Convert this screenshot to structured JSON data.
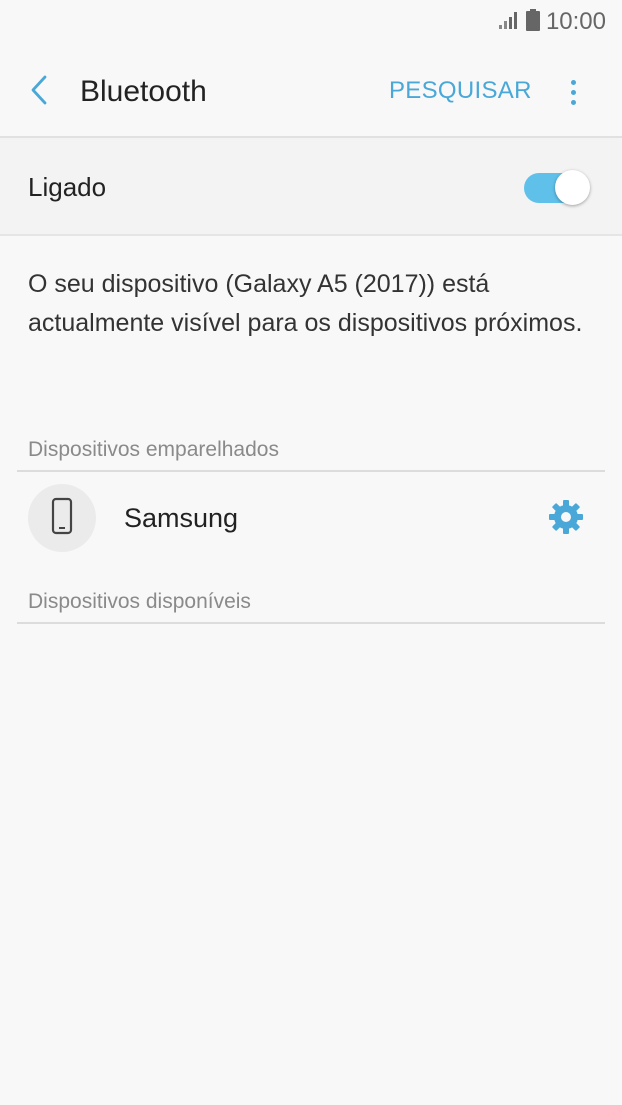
{
  "status_bar": {
    "time": "10:00",
    "signal_icon": "signal-icon",
    "battery_icon": "battery-icon"
  },
  "header": {
    "title": "Bluetooth",
    "back_icon": "chevron-left-icon",
    "search_label": "PESQUISAR",
    "more_icon": "more-vertical-icon"
  },
  "bluetooth_toggle": {
    "label": "Ligado",
    "state": true
  },
  "visibility_message": "O seu dispositivo (Galaxy A5 (2017)) está actualmente visível para os dispositivos próximos.",
  "paired_section": {
    "title": "Dispositivos emparelhados",
    "devices": [
      {
        "name": "Samsung",
        "icon": "smartphone-icon",
        "settings_icon": "gear-icon"
      }
    ]
  },
  "available_section": {
    "title": "Dispositivos disponíveis"
  },
  "colors": {
    "accent": "#4aa8d8",
    "switch_on": "#5fc1e9",
    "background": "#f8f8f8",
    "section_text": "#8a8a8a"
  }
}
